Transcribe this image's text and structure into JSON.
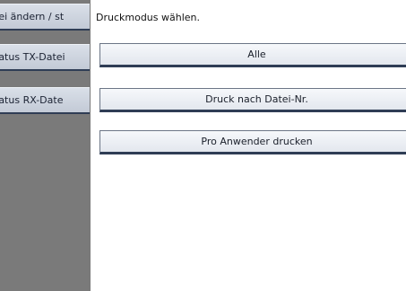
{
  "sidebar": {
    "items": [
      {
        "label": "tei ändern / st"
      },
      {
        "label": "tatus TX-Datei"
      },
      {
        "label": "tatus RX-Date"
      }
    ]
  },
  "main": {
    "prompt": "Druckmodus wählen.",
    "options": [
      {
        "label": "Alle"
      },
      {
        "label": "Druck nach Datei-Nr."
      },
      {
        "label": "Pro Anwender drucken"
      }
    ]
  }
}
